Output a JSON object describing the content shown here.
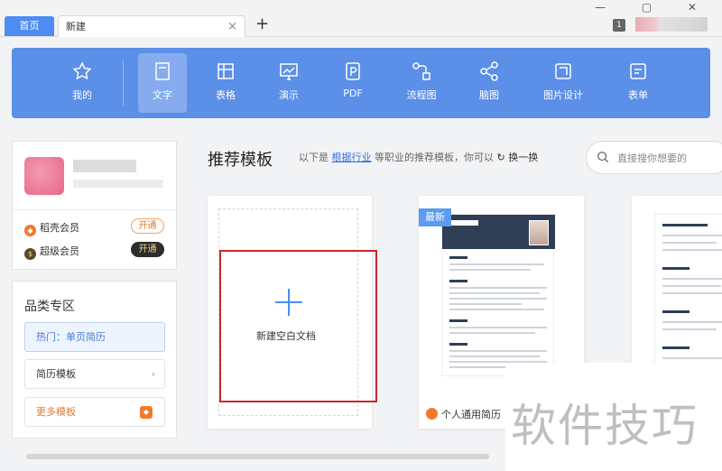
{
  "tabs": {
    "home": "首页",
    "current": "新建",
    "close": "×",
    "add": "+"
  },
  "window": {
    "badge": "1",
    "controls": "— ▢ ✕"
  },
  "toolbar": {
    "items": [
      {
        "label": "我的",
        "icon": "star-icon"
      },
      {
        "label": "文字",
        "icon": "document-icon",
        "active": true
      },
      {
        "label": "表格",
        "icon": "table-icon"
      },
      {
        "label": "演示",
        "icon": "presentation-icon"
      },
      {
        "label": "PDF",
        "icon": "pdf-icon"
      },
      {
        "label": "流程图",
        "icon": "flowchart-icon"
      },
      {
        "label": "脑图",
        "icon": "mindmap-icon"
      },
      {
        "label": "图片设计",
        "icon": "image-design-icon"
      },
      {
        "label": "表单",
        "icon": "form-icon"
      }
    ]
  },
  "profile": {
    "members": [
      {
        "label": "稻壳会员",
        "button": "开通"
      },
      {
        "label": "超级会员",
        "button": "开通"
      }
    ]
  },
  "category": {
    "title": "品类专区",
    "hot": "热门：单页简历",
    "resume": "简历模板",
    "more": "更多模板",
    "arrow": "›"
  },
  "main": {
    "title": "推荐模板",
    "desc_prefix": "以下是",
    "desc_link": "根据行业",
    "desc_suffix": "等职业的推荐模板，你可以",
    "swap": "换一换",
    "search_placeholder": "直接搜你想要的"
  },
  "blank_card": {
    "label": "新建空白文档"
  },
  "template_card": {
    "badge": "最新",
    "caption": "个人通用简历"
  },
  "watermark": "软件技巧",
  "colors": {
    "toolbar": "#5b8fe8",
    "accent": "#4d8cf2",
    "highlight_border": "#c8282c",
    "member_orange": "#f07a2a"
  }
}
